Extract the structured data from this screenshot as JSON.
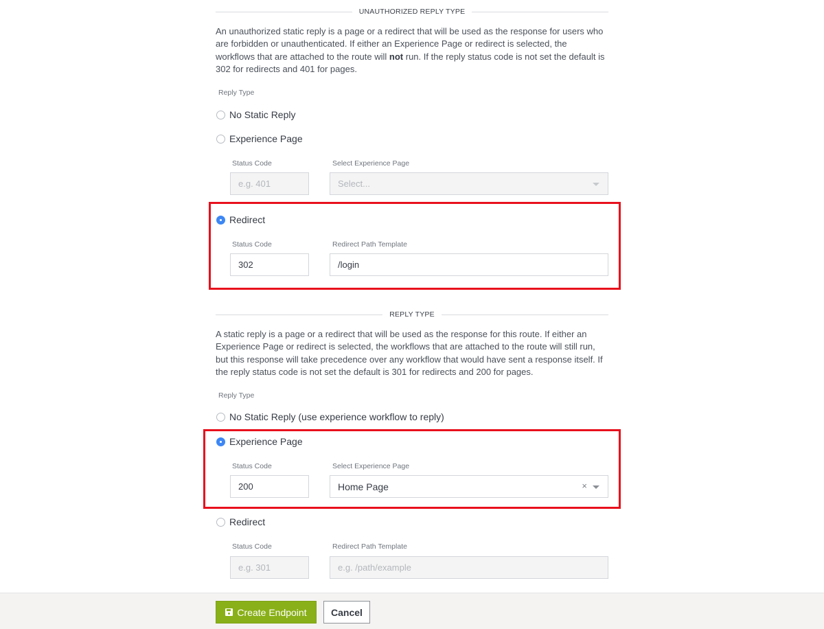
{
  "unauthorized_section": {
    "title": "UNAUTHORIZED REPLY TYPE",
    "description_part1": "An unauthorized static reply is a page or a redirect that will be used as the response for users who are forbidden or unauthenticated. If either an Experience Page or redirect is selected, the workflows that are attached to the route will ",
    "description_bold": "not",
    "description_part2": " run. If the reply status code is not set the default is 302 for redirects and 401 for pages.",
    "reply_type_label": "Reply Type",
    "options": {
      "no_static": {
        "label": "No Static Reply",
        "checked": false
      },
      "experience_page": {
        "label": "Experience Page",
        "checked": false,
        "status_code_label": "Status Code",
        "status_code_placeholder": "e.g. 401",
        "select_label": "Select Experience Page",
        "select_placeholder": "Select..."
      },
      "redirect": {
        "label": "Redirect",
        "checked": true,
        "status_code_label": "Status Code",
        "status_code_value": "302",
        "path_label": "Redirect Path Template",
        "path_value": "/login"
      }
    }
  },
  "reply_section": {
    "title": "REPLY TYPE",
    "description": "A static reply is a page or a redirect that will be used as the response for this route. If either an Experience Page or redirect is selected, the workflows that are attached to the route will still run, but this response will take precedence over any workflow that would have sent a response itself. If the reply status code is not set the default is 301 for redirects and 200 for pages.",
    "reply_type_label": "Reply Type",
    "options": {
      "no_static": {
        "label": "No Static Reply (use experience workflow to reply)",
        "checked": false
      },
      "experience_page": {
        "label": "Experience Page",
        "checked": true,
        "status_code_label": "Status Code",
        "status_code_value": "200",
        "select_label": "Select Experience Page",
        "select_value": "Home Page",
        "clear_glyph": "×"
      },
      "redirect": {
        "label": "Redirect",
        "checked": false,
        "status_code_label": "Status Code",
        "status_code_placeholder": "e.g. 301",
        "path_label": "Redirect Path Template",
        "path_placeholder": "e.g. /path/example"
      }
    }
  },
  "footer": {
    "create_label": "Create Endpoint",
    "cancel_label": "Cancel"
  },
  "colors": {
    "accent_blue": "#3d87f5",
    "primary_green": "#89b018",
    "highlight_red": "#e8101d"
  }
}
